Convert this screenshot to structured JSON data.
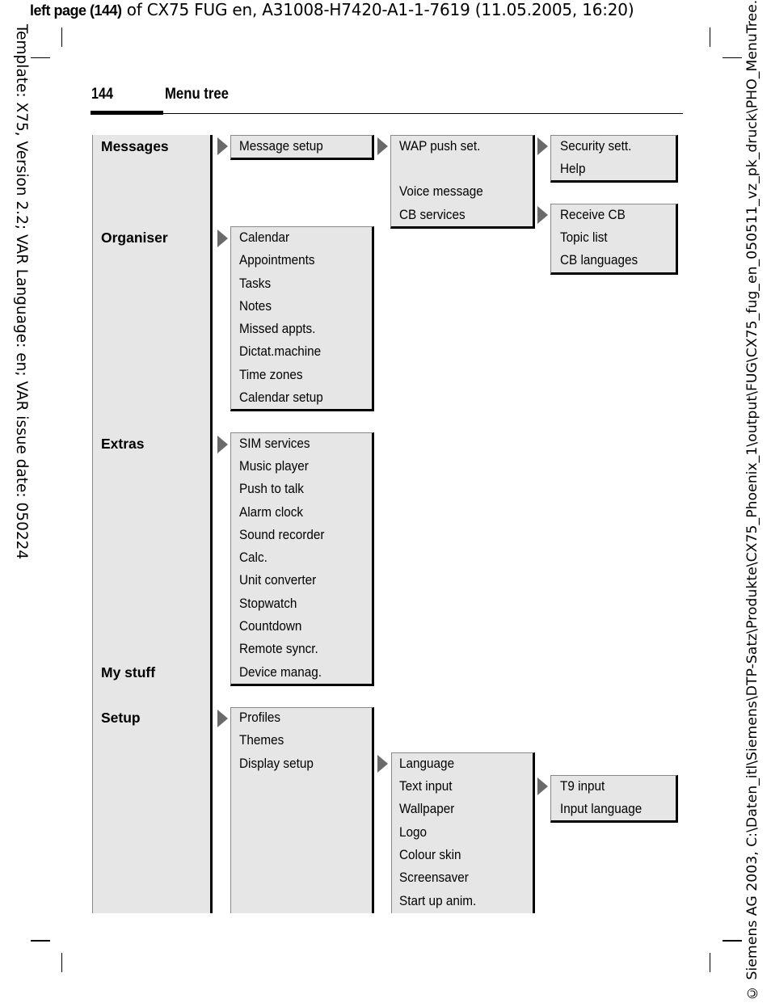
{
  "header_line": {
    "bold": "left page (144)",
    "rest": " of CX75 FUG en, A31008-H7420-A1-1-7619 (11.05.2005, 16:20)"
  },
  "side_left": "Template: X75, Version 2.2; VAR Language: en; VAR issue date: 050224",
  "side_right": "© Siemens AG 2003, C:\\Daten_itl\\Siemens\\DTP-Satz\\Produkte\\CX75_Phoenix_1\\output\\FUG\\CX75_fug_en_050511_vz_pk_druck\\PHO_MenuTree.fm",
  "page": {
    "number": "144",
    "title": "Menu tree"
  },
  "main_menu": [
    "Messages",
    "Organiser",
    "Extras",
    "My stuff",
    "Setup"
  ],
  "messages": {
    "level1": [
      "Message setup"
    ],
    "level2": [
      "WAP push set.",
      "Voice message",
      "CB services"
    ],
    "wap_sub": [
      "Security sett.",
      "Help"
    ],
    "cb_sub": [
      "Receive CB",
      "Topic list",
      "CB languages"
    ]
  },
  "organiser": {
    "items": [
      "Calendar",
      "Appointments",
      "Tasks",
      "Notes",
      "Missed appts.",
      "Dictat.machine",
      "Time zones",
      "Calendar setup"
    ]
  },
  "extras": {
    "items": [
      "SIM services",
      "Music player",
      "Push to talk",
      "Alarm clock",
      "Sound recorder",
      "Calc.",
      "Unit converter",
      "Stopwatch",
      "Countdown",
      "Remote syncr.",
      "Device manag."
    ]
  },
  "setup": {
    "items": [
      "Profiles",
      "Themes",
      "Display setup"
    ],
    "display_sub": [
      "Language",
      "Text input",
      "Wallpaper",
      "Logo",
      "Colour skin",
      "Screensaver",
      "Start up anim."
    ],
    "text_input_sub": [
      "T9 input",
      "Input language"
    ]
  },
  "icons": {
    "submenu_arrow": "right-triangle-icon"
  }
}
